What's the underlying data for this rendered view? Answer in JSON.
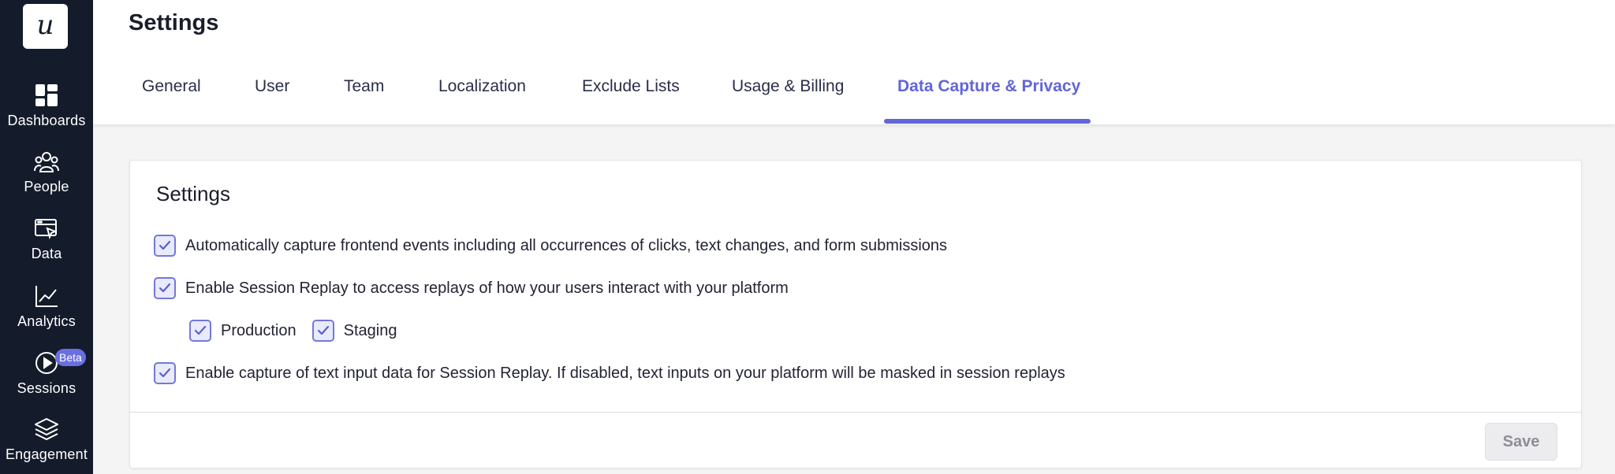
{
  "sidebar": {
    "logo": "u",
    "items": [
      {
        "label": "Dashboards",
        "icon": "dashboard-grid-icon"
      },
      {
        "label": "People",
        "icon": "people-group-icon"
      },
      {
        "label": "Data",
        "icon": "data-window-cursor-icon"
      },
      {
        "label": "Analytics",
        "icon": "line-chart-icon"
      },
      {
        "label": "Sessions",
        "icon": "play-circle-icon",
        "badge": "Beta"
      },
      {
        "label": "Engagement",
        "icon": "layers-icon"
      }
    ]
  },
  "header": {
    "title": "Settings",
    "tabs": [
      {
        "label": "General"
      },
      {
        "label": "User"
      },
      {
        "label": "Team"
      },
      {
        "label": "Localization"
      },
      {
        "label": "Exclude Lists"
      },
      {
        "label": "Usage & Billing"
      },
      {
        "label": "Data Capture & Privacy",
        "active": true
      }
    ]
  },
  "card": {
    "title": "Settings",
    "options": [
      {
        "label": "Automatically capture frontend events including all occurrences of clicks, text changes, and form submissions",
        "checked": true
      },
      {
        "label": "Enable Session Replay to access replays of how your users interact with your platform",
        "checked": true
      },
      {
        "label": "Enable capture of text input data for Session Replay. If disabled, text inputs on your platform will be masked in session replays",
        "checked": true
      }
    ],
    "sub_options": [
      {
        "label": "Production",
        "checked": true
      },
      {
        "label": "Staging",
        "checked": true
      }
    ],
    "save_label": "Save"
  },
  "colors": {
    "sidebar_bg": "#141c2b",
    "accent": "#6266d6",
    "badge": "#6a6fe0"
  }
}
